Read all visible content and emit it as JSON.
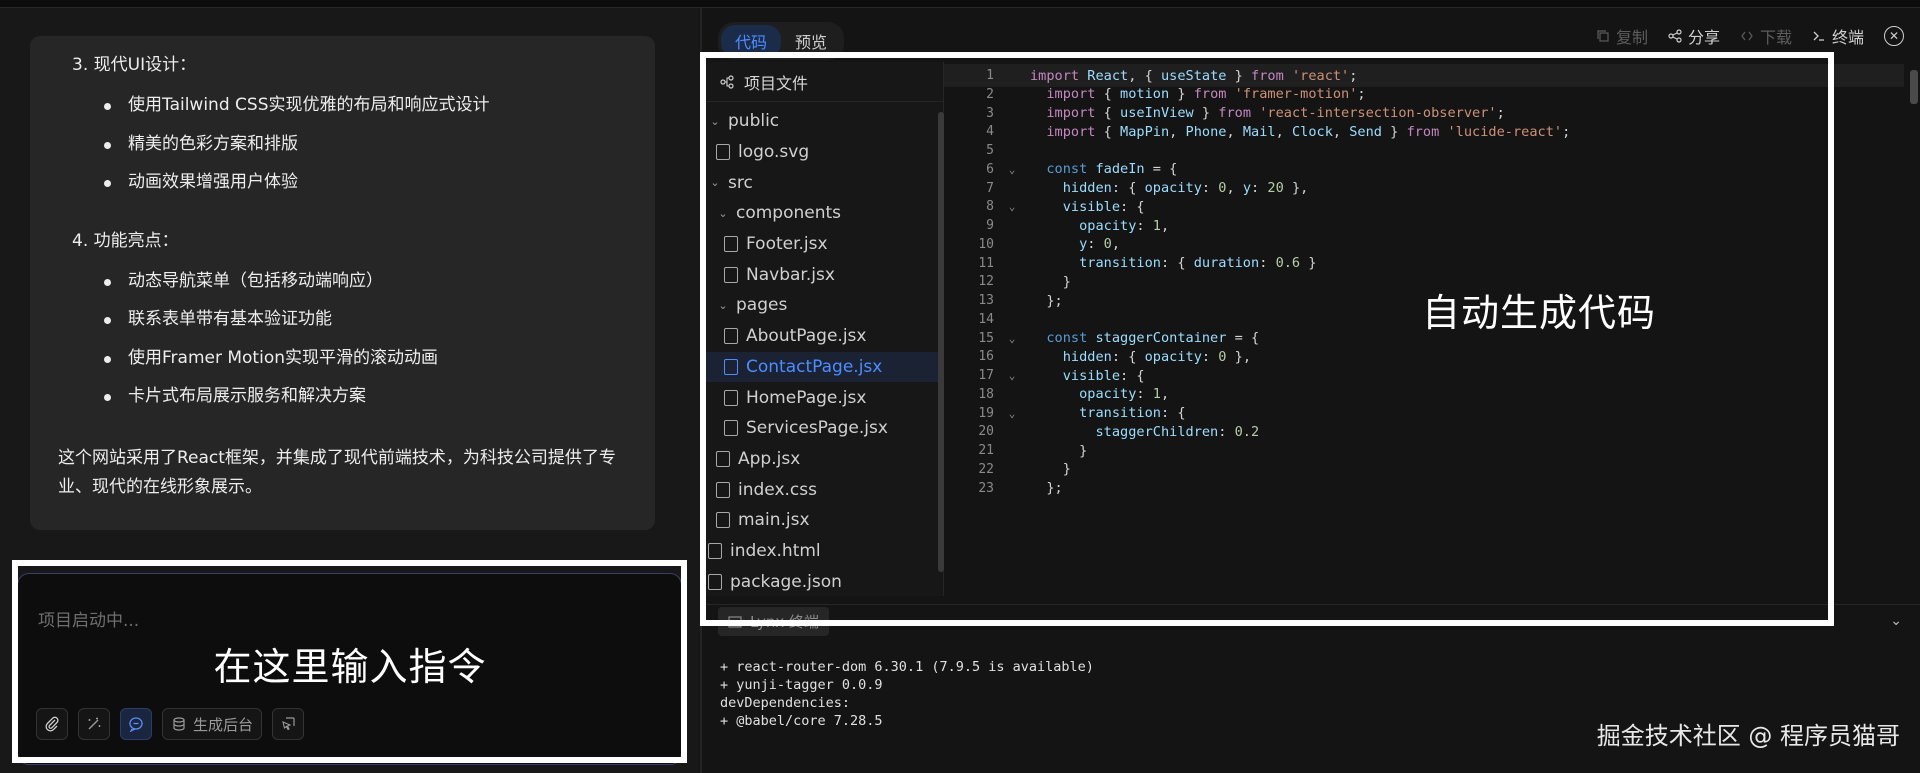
{
  "chat": {
    "sections": [
      {
        "heading": "3. 现代UI设计：",
        "items": [
          "使用Tailwind CSS实现优雅的布局和响应式设计",
          "精美的色彩方案和排版",
          "动画效果增强用户体验"
        ]
      },
      {
        "heading": "4. 功能亮点：",
        "items": [
          "动态导航菜单（包括移动端响应）",
          "联系表单带有基本验证功能",
          "使用Framer Motion实现平滑的滚动动画",
          "卡片式布局展示服务和解决方案"
        ]
      }
    ],
    "summary": "这个网站采用了React框架，并集成了现代前端技术，为科技公司提供了专业、现代的在线形象展示。"
  },
  "input": {
    "placeholder": "项目启动中...",
    "generate_backend_label": "生成后台"
  },
  "annotations": {
    "left": "在这里输入指令",
    "right": "自动生成代码"
  },
  "right_header": {
    "tabs": [
      "代码",
      "预览"
    ],
    "active_tab": 0,
    "actions": {
      "copy": "复制",
      "share": "分享",
      "download": "下载",
      "terminal": "终端"
    }
  },
  "file_tree": {
    "title": "项目文件",
    "items": [
      {
        "name": "public",
        "type": "folder",
        "depth": 0
      },
      {
        "name": "logo.svg",
        "type": "file",
        "depth": 1
      },
      {
        "name": "src",
        "type": "folder",
        "depth": 0
      },
      {
        "name": "components",
        "type": "folder",
        "depth": 1
      },
      {
        "name": "Footer.jsx",
        "type": "file",
        "depth": 2
      },
      {
        "name": "Navbar.jsx",
        "type": "file",
        "depth": 2
      },
      {
        "name": "pages",
        "type": "folder",
        "depth": 1
      },
      {
        "name": "AboutPage.jsx",
        "type": "file",
        "depth": 2
      },
      {
        "name": "ContactPage.jsx",
        "type": "file",
        "depth": 2,
        "selected": true
      },
      {
        "name": "HomePage.jsx",
        "type": "file",
        "depth": 2
      },
      {
        "name": "ServicesPage.jsx",
        "type": "file",
        "depth": 2
      },
      {
        "name": "App.jsx",
        "type": "file",
        "depth": 1
      },
      {
        "name": "index.css",
        "type": "file",
        "depth": 1
      },
      {
        "name": "main.jsx",
        "type": "file",
        "depth": 1
      },
      {
        "name": "index.html",
        "type": "file",
        "depth": 0
      },
      {
        "name": "package.json",
        "type": "file",
        "depth": 0
      }
    ]
  },
  "code": {
    "lines": [
      "import React, { useState } from 'react';",
      "  import { motion } from 'framer-motion';",
      "  import { useInView } from 'react-intersection-observer';",
      "  import { MapPin, Phone, Mail, Clock, Send } from 'lucide-react';",
      "",
      "  const fadeIn = {",
      "    hidden: { opacity: 0, y: 20 },",
      "    visible: {",
      "      opacity: 1,",
      "      y: 0,",
      "      transition: { duration: 0.6 }",
      "    }",
      "  };",
      "",
      "  const staggerContainer = {",
      "    hidden: { opacity: 0 },",
      "    visible: {",
      "      opacity: 1,",
      "      transition: {",
      "        staggerChildren: 0.2",
      "      }",
      "    }",
      "  };"
    ],
    "fold_lines": [
      6,
      8,
      15,
      17,
      19
    ]
  },
  "terminal": {
    "tab_label": "Lynx 终端",
    "lines": [
      "+ react-router-dom 6.30.1 (7.9.5 is available)",
      "+ yunji-tagger 0.0.9",
      "devDependencies:",
      "+ @babel/core 7.28.5"
    ]
  },
  "watermark": "掘金技术社区 @ 程序员猫哥"
}
